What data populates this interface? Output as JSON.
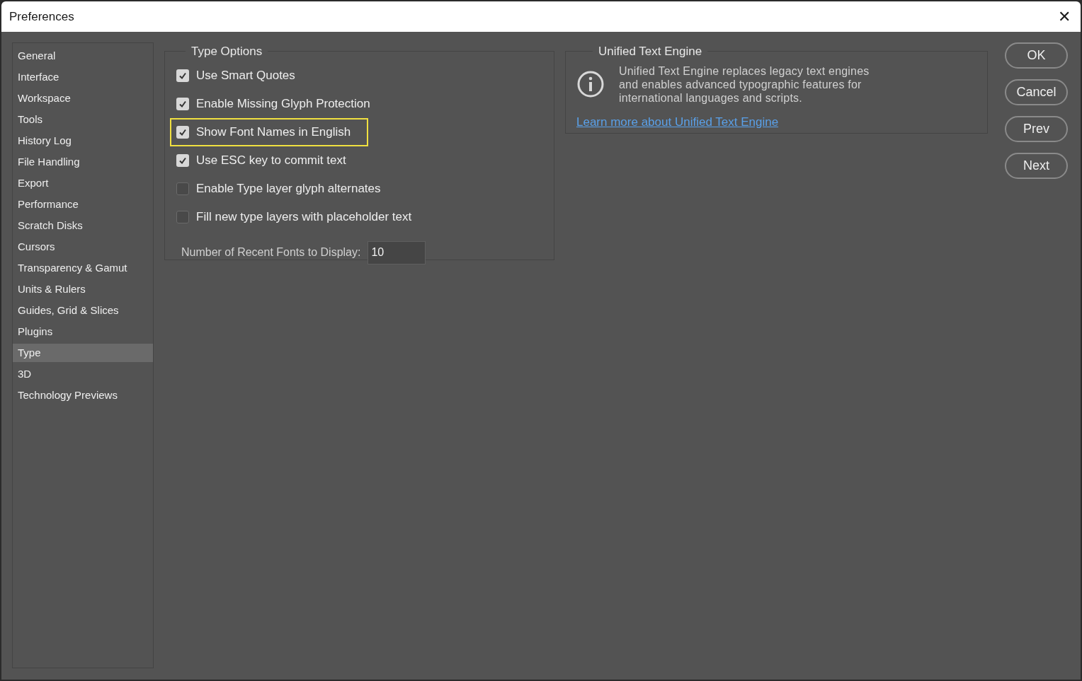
{
  "window": {
    "title": "Preferences",
    "close": "✕"
  },
  "sidebar": {
    "items": [
      {
        "label": "General",
        "selected": false
      },
      {
        "label": "Interface",
        "selected": false
      },
      {
        "label": "Workspace",
        "selected": false
      },
      {
        "label": "Tools",
        "selected": false
      },
      {
        "label": "History Log",
        "selected": false
      },
      {
        "label": "File Handling",
        "selected": false
      },
      {
        "label": "Export",
        "selected": false
      },
      {
        "label": "Performance",
        "selected": false
      },
      {
        "label": "Scratch Disks",
        "selected": false
      },
      {
        "label": "Cursors",
        "selected": false
      },
      {
        "label": "Transparency & Gamut",
        "selected": false
      },
      {
        "label": "Units & Rulers",
        "selected": false
      },
      {
        "label": "Guides, Grid & Slices",
        "selected": false
      },
      {
        "label": "Plugins",
        "selected": false
      },
      {
        "label": "Type",
        "selected": true
      },
      {
        "label": "3D",
        "selected": false
      },
      {
        "label": "Technology Previews",
        "selected": false
      }
    ]
  },
  "type_options": {
    "title": "Type Options",
    "options": [
      {
        "label": "Use Smart Quotes",
        "checked": true,
        "highlighted": false
      },
      {
        "label": "Enable Missing Glyph Protection",
        "checked": true,
        "highlighted": false
      },
      {
        "label": "Show Font Names in English",
        "checked": true,
        "highlighted": true
      },
      {
        "label": "Use ESC key to commit text",
        "checked": true,
        "highlighted": false
      },
      {
        "label": "Enable Type layer glyph alternates",
        "checked": false,
        "highlighted": false
      },
      {
        "label": "Fill new type layers with placeholder text",
        "checked": false,
        "highlighted": false
      }
    ],
    "recent_fonts": {
      "label": "Number of Recent Fonts to Display:",
      "value": "10"
    }
  },
  "unified_text_engine": {
    "title": "Unified Text Engine",
    "description": "Unified Text Engine replaces legacy text engines and enables advanced typographic features for international languages and scripts.",
    "link": "Learn more about Unified Text Engine"
  },
  "buttons": [
    "OK",
    "Cancel",
    "Prev",
    "Next"
  ]
}
